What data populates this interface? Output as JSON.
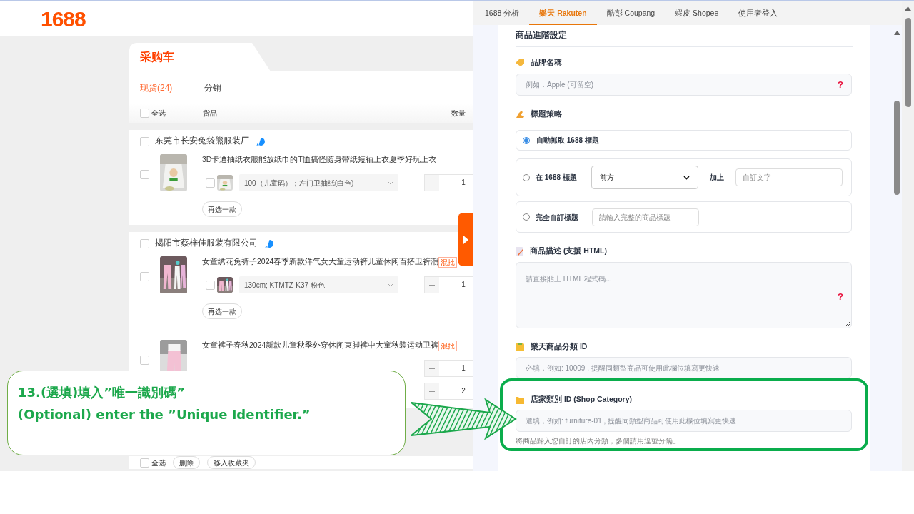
{
  "site": {
    "logo": "1688"
  },
  "cart": {
    "title": "采购车",
    "tabs": [
      {
        "label": "现货(24)",
        "selected": true
      },
      {
        "label": "分销",
        "selected": false
      }
    ],
    "columns": {
      "select_all": "全选",
      "goods": "货品",
      "quantity": "数量"
    },
    "select_all_checked": false,
    "stores": [
      {
        "name": "东莞市长安兔袋熊服装厂",
        "checked": false,
        "items": [
          {
            "title": "3D卡通抽纸衣服能放纸巾的T恤搞怪随身带纸短袖上衣夏季好玩上衣",
            "checked": false,
            "spec": "100（儿童码）；左门卫抽纸(白色)",
            "spec_checked": false,
            "quantity": "1",
            "reselect": "再选一款"
          }
        ]
      },
      {
        "name": "揭阳市蔡梓佳服装有限公司",
        "checked": false,
        "items": [
          {
            "title": "女童绣花兔裤子2024春季新款洋气女大童运动裤儿童休闲百搭卫裤潮",
            "badge": "混批",
            "checked": false,
            "spec": "130cm; KTMTZ-K37 粉色",
            "spec_checked": false,
            "quantity": "1",
            "reselect": "再选一款"
          },
          {
            "title": "女童裤子春秋2024新款儿童秋季外穿休闲束脚裤中大童秋装运动卫裤",
            "badge": "混批",
            "checked": false,
            "quantity": "1"
          },
          {
            "quantity": "2"
          }
        ]
      }
    ],
    "footer": {
      "select_all": "全选",
      "checked": false,
      "buttons": [
        "删除",
        "移入收藏夹"
      ]
    }
  },
  "panel": {
    "tabs": [
      {
        "label": "1688 分析",
        "selected": false
      },
      {
        "label": "樂天 Rakuten",
        "selected": true
      },
      {
        "label": "酷彭 Coupang",
        "selected": false
      },
      {
        "label": "蝦皮 Shopee",
        "selected": false
      },
      {
        "label": "使用者登入",
        "selected": false
      }
    ],
    "section_title": "商品進階設定",
    "brand": {
      "label": "品牌名稱",
      "placeholder": "例如：Apple (可留空)",
      "help": "?"
    },
    "title_strategy": {
      "label": "標題策略",
      "options": [
        {
          "kind": "plain",
          "label": "自動抓取 1688 標題",
          "selected": true
        },
        {
          "kind": "affix",
          "label": "在 1688 標題",
          "position": "前方",
          "join": "加上",
          "placeholder": "自訂文字",
          "selected": false
        },
        {
          "kind": "custom",
          "label": "完全自訂標題",
          "placeholder": "請輸入完整的商品標題",
          "selected": false
        }
      ]
    },
    "description": {
      "label": "商品描述 (支援 HTML)",
      "placeholder": "請直接貼上 HTML 程式碼...",
      "help": "?"
    },
    "rakuten_category": {
      "label": "樂天商品分類 ID",
      "placeholder": "必填，例如: 10009 , 提醒同類型商品可使用此欄位填寫更快速"
    },
    "shop_category": {
      "label": "店家類別 ID (Shop Category)",
      "placeholder": "選填，例如: furniture-01 , 提醒同類型商品可使用此欄位填寫更快速",
      "hint": "將商品歸入您自訂的店內分類，多個請用逗號分隔。",
      "highlighted": true
    }
  },
  "annotation": {
    "lines": [
      "13.(選填)填入”唯一識別碼”",
      "(Optional) enter the ”Unique Identifier.”"
    ]
  }
}
